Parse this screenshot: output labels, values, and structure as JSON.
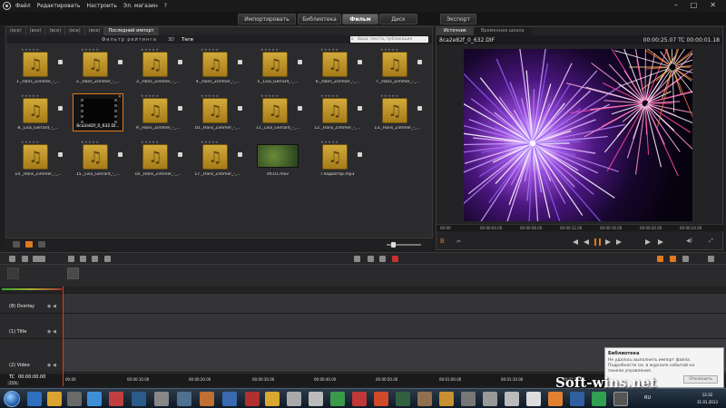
{
  "menubar": {
    "items": [
      "Файл",
      "Редактировать",
      "Настроить",
      "Эл. магазин",
      "?"
    ]
  },
  "modes": {
    "import": "Импортировать",
    "library": "Библиотека",
    "movie": "Фильм",
    "disc": "Диск",
    "export": "Экспорт"
  },
  "library": {
    "tabs": [
      "(все)",
      "(все)",
      "(все)",
      "(все)",
      "(все)",
      "Последний импорт"
    ],
    "filter_label": "Фильтр рейтинга",
    "view_3d": "3D",
    "tags_label": "Теги",
    "search_placeholder": "Ввод текста, публикация",
    "items": [
      {
        "caption": "1._Hans_Zimmer_-_...",
        "type": "audio"
      },
      {
        "caption": "2._Hans_Zimmer_-_...",
        "type": "audio"
      },
      {
        "caption": "3._Hans_Zimmer_-_...",
        "type": "audio"
      },
      {
        "caption": "4._Hans_Zimmer_-_...",
        "type": "audio"
      },
      {
        "caption": "5._Lisa_Gerrard_-_...",
        "type": "audio"
      },
      {
        "caption": "6._Hans_Zimmer_-_...",
        "type": "audio"
      },
      {
        "caption": "7._Hans_Zimmer_-_...",
        "type": "audio"
      },
      {
        "caption": "8._Lisa_Gerrard_-_...",
        "type": "audio"
      },
      {
        "caption": "8ca2e82f_0_632.DI...",
        "type": "video-selected"
      },
      {
        "caption": "9._Hans_Zimmer_-_...",
        "type": "audio"
      },
      {
        "caption": "10._Hans_Zimmer_-_...",
        "type": "audio"
      },
      {
        "caption": "11._Lisa_Gerrard_-_...",
        "type": "audio"
      },
      {
        "caption": "12._Hans_Zimmer_-_...",
        "type": "audio"
      },
      {
        "caption": "13._Hans_Zimmer_-_...",
        "type": "audio"
      },
      {
        "caption": "14._Hans_Zimmer_-_...",
        "type": "audio"
      },
      {
        "caption": "15._Lisa_Gerrard_-_...",
        "type": "audio"
      },
      {
        "caption": "16._Hans_Zimmer_-_...",
        "type": "audio"
      },
      {
        "caption": "17._Hans_Zimmer_-_...",
        "type": "audio"
      },
      {
        "caption": "sfC01.mov",
        "type": "video"
      },
      {
        "caption": "Гладиатор.mp3",
        "type": "audio"
      }
    ]
  },
  "player": {
    "tab_source": "Источник",
    "tab_timeline": "Временная шкала",
    "file_name": "8ca2e82f_0_632.DIF",
    "duration": "00:00:25.07",
    "timecode_label": "TC",
    "timecode": "00:00:01.18",
    "ruler": [
      "00:00",
      "00:00:04.00",
      "00:00:08.00",
      "00:00:12.00",
      "00:00:16.00",
      "00:00:20.00",
      "00:00:24.00"
    ]
  },
  "timeline": {
    "tracks": [
      {
        "name": "(8) Overlay"
      },
      {
        "name": "(1) Title"
      },
      {
        "name": "(2) Video"
      }
    ],
    "tc_label": "TC",
    "tc_value": "00:00:00.00",
    "zoom_pct": "25%",
    "ticks": [
      "00:00",
      "00:00:10.00",
      "00:00:20.00",
      "00:00:30.00",
      "00:00:40.00",
      "00:00:50.00",
      "00:01:00.00",
      "00:01:10.00",
      "00:01:20.00"
    ]
  },
  "notification": {
    "title": "Библиотека",
    "line1": "Не удалось выполнить импорт файла.",
    "line2": "Подробности см. в журнале событий на",
    "line3": "панели управления.",
    "button": "Отклонить"
  },
  "taskbar": {
    "lang": "RU",
    "time": "12:32",
    "date": "31.01.2013"
  },
  "watermark": "Soft-wins.net",
  "colors": {
    "accent": "#e07a1f",
    "audio_tile": "#c89b2e"
  }
}
